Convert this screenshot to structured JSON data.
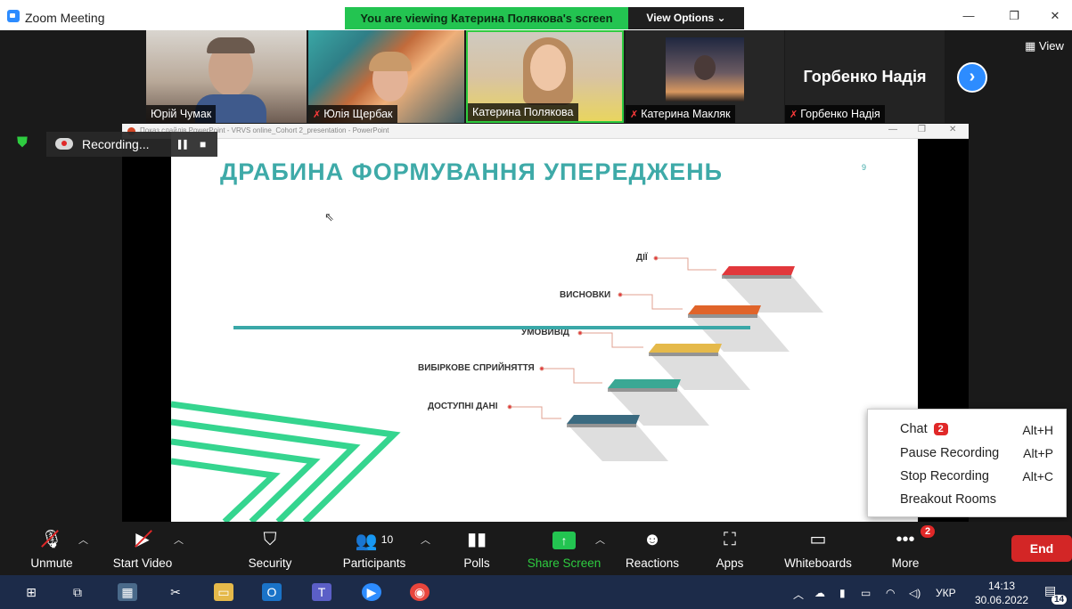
{
  "window": {
    "title": "Zoom Meeting",
    "banner": "You are viewing Катерина Полякова's screen",
    "view_options": "View Options ⌄",
    "minimize": "—",
    "restore": "❐",
    "close": "✕"
  },
  "gallery": {
    "participants": [
      {
        "name": "Юрій Чумак",
        "muted": false
      },
      {
        "name": "Юлія Щербак",
        "muted": true
      },
      {
        "name": "Катерина Полякова",
        "muted": false,
        "active_speaker": true
      },
      {
        "name": "Катерина Макляк",
        "muted": true
      },
      {
        "name": "Горбенко Надія",
        "muted": true,
        "display_name_large": "Горбенко Надія"
      }
    ],
    "next_arrow": "›",
    "view_label": "▦ View"
  },
  "recording": {
    "label": "Recording...",
    "pause": "▌▌",
    "stop": "■"
  },
  "powerpoint": {
    "window_title": "Показ слайдів PowerPoint - VRVS online_Cohort 2_presentation - PowerPoint",
    "slide_title": "ДРАБИНА ФОРМУВАННЯ УПЕРЕДЖЕНЬ",
    "slide_number": "9",
    "steps": [
      "ДІЇ",
      "ВИСНОВКИ",
      "УМОВИВІД",
      "ВИБІРКОВЕ СПРИЙНЯТТЯ",
      "ДОСТУПНІ ДАНІ"
    ],
    "step_colors": [
      "#e2383c",
      "#e0642a",
      "#e5b94a",
      "#3aa894",
      "#3a6a80"
    ]
  },
  "more_menu": {
    "items": [
      {
        "label": "Chat",
        "badge": "2",
        "shortcut": "Alt+H"
      },
      {
        "label": "Pause Recording",
        "shortcut": "Alt+P"
      },
      {
        "label": "Stop Recording",
        "shortcut": "Alt+C"
      },
      {
        "label": "Breakout Rooms",
        "shortcut": ""
      }
    ]
  },
  "toolbar": {
    "unmute": "Unmute",
    "start_video": "Start Video",
    "security": "Security",
    "participants": "Participants",
    "participants_count": "10",
    "polls": "Polls",
    "share_screen": "Share Screen",
    "reactions": "Reactions",
    "apps": "Apps",
    "whiteboards": "Whiteboards",
    "more": "More",
    "more_badge": "2",
    "end": "End",
    "share_color": "#23c451",
    "end_color": "#d32626"
  },
  "taskbar": {
    "language": "УКР",
    "time": "14:13",
    "date": "30.06.2022",
    "notifications": "14"
  }
}
